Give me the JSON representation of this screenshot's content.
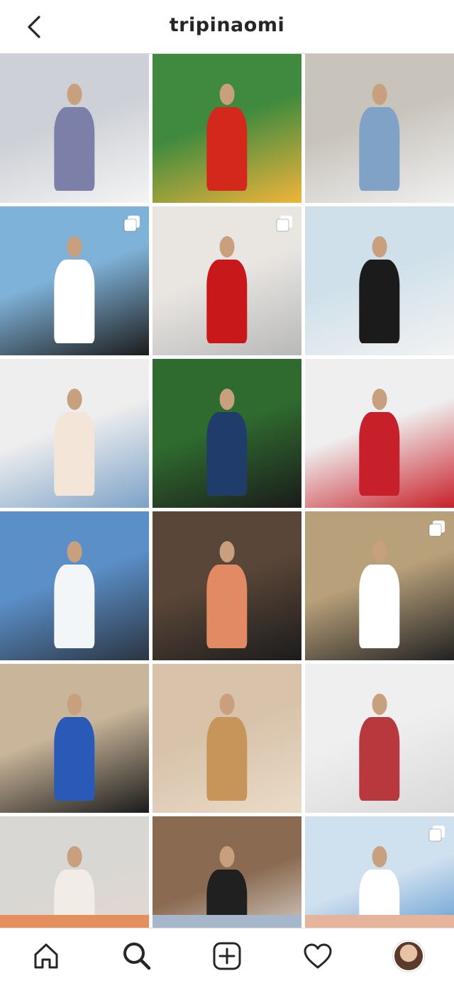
{
  "header": {
    "username": "tripinaomi",
    "back_icon": "chevron-left-icon"
  },
  "grid": {
    "posts": [
      {
        "id": 1,
        "colors": [
          "#cdd0d6",
          "#7c7fa8",
          "#f4f4f4"
        ],
        "multi": false
      },
      {
        "id": 2,
        "colors": [
          "#3f8a3f",
          "#d4281c",
          "#f0b43a"
        ],
        "multi": false
      },
      {
        "id": 3,
        "colors": [
          "#c8c4bc",
          "#7fa2c6",
          "#efefef"
        ],
        "multi": false
      },
      {
        "id": 4,
        "colors": [
          "#7fb2d8",
          "#ffffff",
          "#1c1c1c"
        ],
        "multi": true
      },
      {
        "id": 5,
        "colors": [
          "#e9e6e2",
          "#c8181a",
          "#b9b9b9"
        ],
        "multi": true
      },
      {
        "id": 6,
        "colors": [
          "#cfe0ea",
          "#1b1b1b",
          "#f2f2f2"
        ],
        "multi": false
      },
      {
        "id": 7,
        "colors": [
          "#eeeeee",
          "#f3e6d8",
          "#7da2c8"
        ],
        "multi": false
      },
      {
        "id": 8,
        "colors": [
          "#2f6b2f",
          "#203c6b",
          "#1b1b1b"
        ],
        "multi": false
      },
      {
        "id": 9,
        "colors": [
          "#efefef",
          "#c8202a",
          "#c8202a"
        ],
        "multi": false
      },
      {
        "id": 10,
        "colors": [
          "#5b8fc8",
          "#f3f6f8",
          "#2b3542"
        ],
        "multi": false
      },
      {
        "id": 11,
        "colors": [
          "#5a4638",
          "#e28a64",
          "#1c1c1c"
        ],
        "multi": false
      },
      {
        "id": 12,
        "colors": [
          "#b8a07a",
          "#ffffff",
          "#222222"
        ],
        "multi": true
      },
      {
        "id": 13,
        "colors": [
          "#c9b59a",
          "#2a5ab8",
          "#1b1b1b"
        ],
        "multi": false
      },
      {
        "id": 14,
        "colors": [
          "#d8c2aa",
          "#c7955a",
          "#eadbc8"
        ],
        "multi": false
      },
      {
        "id": 15,
        "colors": [
          "#efefef",
          "#b8383e",
          "#d9d9d9"
        ],
        "multi": false
      },
      {
        "id": 16,
        "colors": [
          "#d9d7d3",
          "#f2ece6",
          "#e7d7d0"
        ],
        "multi": false
      },
      {
        "id": 17,
        "colors": [
          "#8a6a50",
          "#202020",
          "#f2f2f2"
        ],
        "multi": false
      },
      {
        "id": 18,
        "colors": [
          "#cfe0ee",
          "#ffffff",
          "#3a82c8"
        ],
        "multi": true
      }
    ],
    "partial_colors": [
      "#e58f5e",
      "#a6b7cc",
      "#e6b49a"
    ]
  },
  "tabbar": {
    "items": [
      {
        "name": "home",
        "icon": "home-icon"
      },
      {
        "name": "search",
        "icon": "search-icon"
      },
      {
        "name": "create",
        "icon": "plus-square-icon"
      },
      {
        "name": "activity",
        "icon": "heart-icon"
      },
      {
        "name": "profile",
        "icon": "profile-avatar"
      }
    ]
  }
}
